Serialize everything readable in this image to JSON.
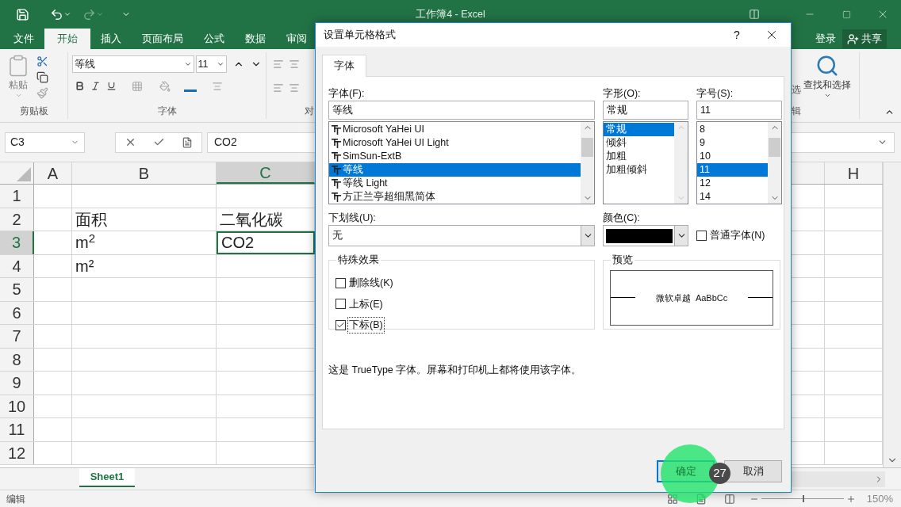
{
  "window": {
    "title": "工作簿4 - Excel"
  },
  "ribbon_tabs": [
    {
      "label": "文件",
      "selected": false
    },
    {
      "label": "开始",
      "selected": true
    },
    {
      "label": "插入",
      "selected": false
    },
    {
      "label": "页面布局",
      "selected": false
    },
    {
      "label": "公式",
      "selected": false
    },
    {
      "label": "数据",
      "selected": false
    },
    {
      "label": "审阅",
      "selected": false
    }
  ],
  "account": {
    "sign_in": "登录",
    "share": "共享"
  },
  "ribbon": {
    "clipboard": {
      "paste": "粘贴",
      "label": "剪贴板"
    },
    "font": {
      "name": "等线",
      "size": "11",
      "label": "字体"
    },
    "alignment": {
      "label": "对"
    },
    "editing": {
      "filter_partial": "选",
      "find_select": "查找和选择",
      "label": "辑"
    }
  },
  "formula_bar": {
    "name_box": "C3",
    "value": "CO2"
  },
  "sheet": {
    "columns": [
      {
        "label": "A",
        "selected": false
      },
      {
        "label": "B",
        "selected": false
      },
      {
        "label": "C",
        "selected": true
      },
      {
        "label": "H",
        "selected": false
      }
    ],
    "rows": [
      {
        "label": "1",
        "selected": false,
        "cells": [
          {
            "selected": false
          },
          {
            "selected": false
          },
          {
            "selected": false
          },
          {
            "selected": false
          }
        ]
      },
      {
        "label": "2",
        "selected": false,
        "cells": [
          {
            "selected": false
          },
          {
            "selected": false,
            "text": "面积"
          },
          {
            "selected": false,
            "text": "二氧化碳"
          },
          {
            "selected": false
          }
        ]
      },
      {
        "label": "3",
        "selected": true,
        "cells": [
          {
            "selected": false
          },
          {
            "selected": false,
            "text": "m$^{2}$"
          },
          {
            "selected": true,
            "text": "CO2"
          },
          {
            "selected": false
          }
        ]
      },
      {
        "label": "4",
        "selected": false,
        "cells": [
          {
            "selected": false
          },
          {
            "selected": false,
            "text": "m²"
          },
          {
            "selected": false
          },
          {
            "selected": false
          }
        ]
      },
      {
        "label": "5",
        "selected": false,
        "cells": [
          {
            "selected": false
          },
          {
            "selected": false
          },
          {
            "selected": false
          },
          {
            "selected": false
          }
        ]
      },
      {
        "label": "6",
        "selected": false,
        "cells": [
          {
            "selected": false
          },
          {
            "selected": false
          },
          {
            "selected": false
          },
          {
            "selected": false
          }
        ]
      },
      {
        "label": "7",
        "selected": false,
        "cells": [
          {
            "selected": false
          },
          {
            "selected": false
          },
          {
            "selected": false
          },
          {
            "selected": false
          }
        ]
      },
      {
        "label": "8",
        "selected": false,
        "cells": [
          {
            "selected": false
          },
          {
            "selected": false
          },
          {
            "selected": false
          },
          {
            "selected": false
          }
        ]
      },
      {
        "label": "9",
        "selected": false,
        "cells": [
          {
            "selected": false
          },
          {
            "selected": false
          },
          {
            "selected": false
          },
          {
            "selected": false
          }
        ]
      },
      {
        "label": "10",
        "selected": false,
        "cells": [
          {
            "selected": false
          },
          {
            "selected": false
          },
          {
            "selected": false
          },
          {
            "selected": false
          }
        ]
      },
      {
        "label": "11",
        "selected": false,
        "cells": [
          {
            "selected": false
          },
          {
            "selected": false
          },
          {
            "selected": false
          },
          {
            "selected": false
          }
        ]
      },
      {
        "label": "12",
        "selected": false,
        "cells": [
          {
            "selected": false
          },
          {
            "selected": false
          },
          {
            "selected": false
          },
          {
            "selected": false
          }
        ]
      }
    ]
  },
  "sheet_tabs": [
    {
      "label": "Sheet1",
      "selected": true
    }
  ],
  "status_bar": {
    "mode": "编辑",
    "zoom": "150%",
    "level": 0.5
  },
  "dialog": {
    "title": "设置单元格格式",
    "help": "?",
    "tabs": [
      {
        "label": "字体",
        "selected": true
      }
    ],
    "font": {
      "label": "字体(F):",
      "value": "等线",
      "options": [
        {
          "label": "Microsoft YaHei UI",
          "selected": false
        },
        {
          "label": "Microsoft YaHei UI Light",
          "selected": false
        },
        {
          "label": "SimSun-ExtB",
          "selected": false
        },
        {
          "label": "等线",
          "selected": true
        },
        {
          "label": "等线 Light",
          "selected": false
        },
        {
          "label": "方正兰亭超细黑简体",
          "selected": false
        }
      ]
    },
    "style": {
      "label": "字形(O):",
      "value": "常规",
      "options": [
        {
          "label": "常规",
          "selected": true
        },
        {
          "label": "倾斜",
          "selected": false
        },
        {
          "label": "加粗",
          "selected": false
        },
        {
          "label": "加粗倾斜",
          "selected": false
        }
      ]
    },
    "size": {
      "label": "字号(S):",
      "value": "11",
      "options": [
        {
          "label": "8",
          "selected": false
        },
        {
          "label": "9",
          "selected": false
        },
        {
          "label": "10",
          "selected": false
        },
        {
          "label": "11",
          "selected": true
        },
        {
          "label": "12",
          "selected": false
        },
        {
          "label": "14",
          "selected": false
        }
      ]
    },
    "underline": {
      "label": "下划线(U):",
      "value": "无"
    },
    "color": {
      "label": "颜色(C):",
      "color": "#000000"
    },
    "normal_font": {
      "label": "普通字体(N)",
      "checked": false
    },
    "effects": {
      "label": "特殊效果",
      "items": [
        {
          "label": "删除线(K)",
          "checked": false
        },
        {
          "label": "上标(E)",
          "checked": false
        },
        {
          "label": "下标(B)",
          "checked": true
        }
      ]
    },
    "preview": {
      "label": "预览",
      "sample": "微软卓越  AaBbCc"
    },
    "note": "这是 TrueType 字体。屏幕和打印机上都将使用该字体。",
    "buttons": [
      {
        "label": "确定",
        "kind": "default"
      },
      {
        "label": "取消",
        "kind": "normal"
      }
    ],
    "click_marker": {
      "step": "27"
    }
  }
}
